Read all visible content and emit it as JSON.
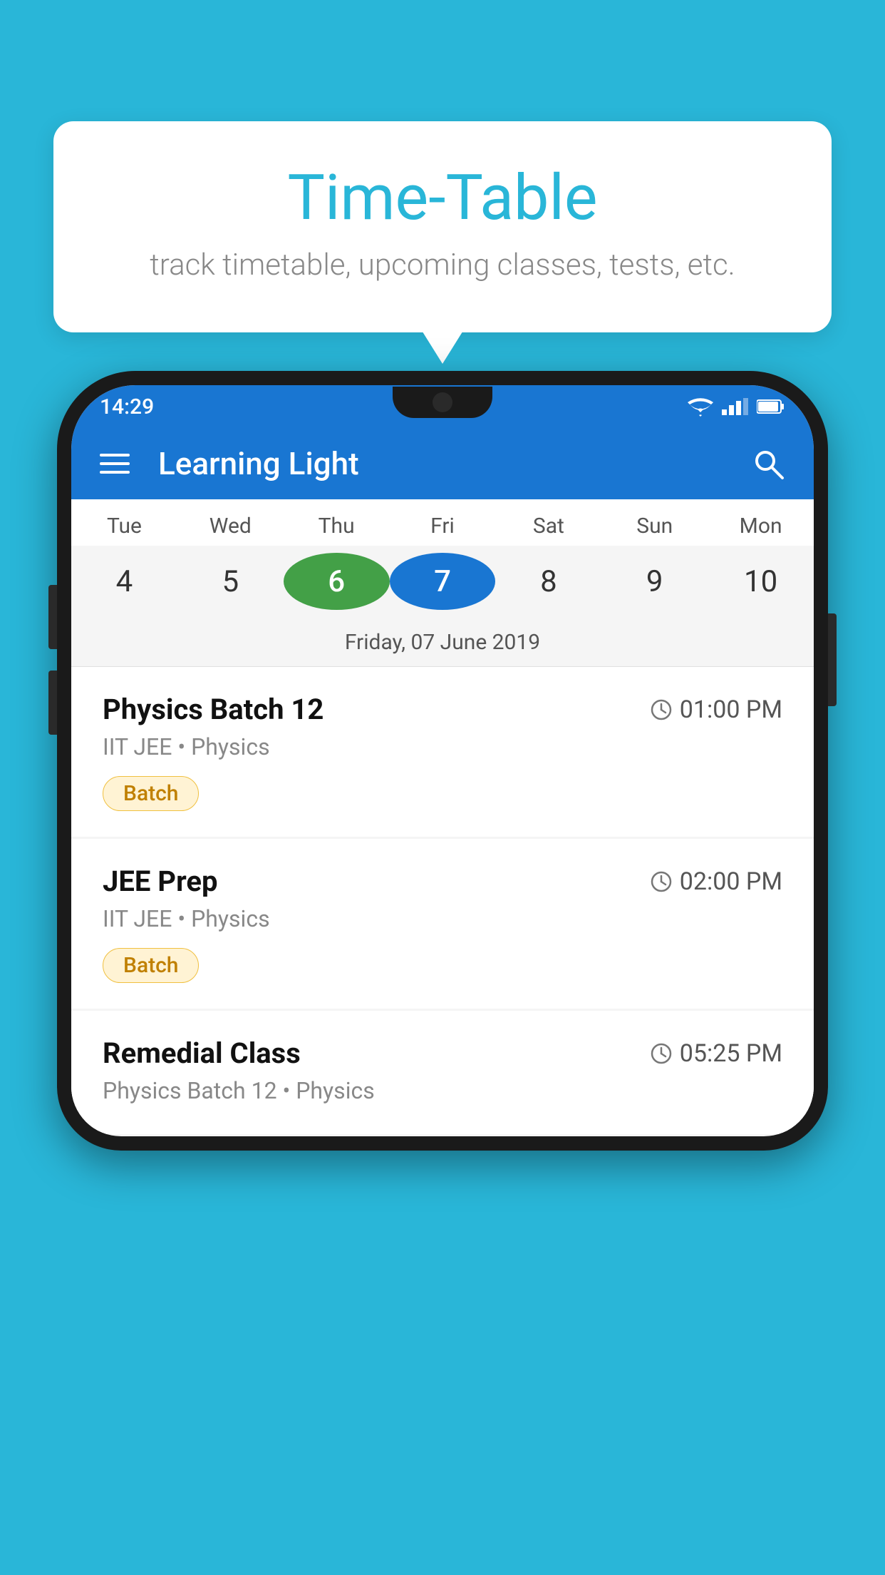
{
  "background_color": "#29b6d8",
  "tooltip": {
    "title": "Time-Table",
    "subtitle": "track timetable, upcoming classes, tests, etc."
  },
  "phone": {
    "status_bar": {
      "time": "14:29"
    },
    "app_bar": {
      "title": "Learning Light"
    },
    "calendar": {
      "days": [
        {
          "name": "Tue",
          "num": "4",
          "state": "normal"
        },
        {
          "name": "Wed",
          "num": "5",
          "state": "normal"
        },
        {
          "name": "Thu",
          "num": "6",
          "state": "today"
        },
        {
          "name": "Fri",
          "num": "7",
          "state": "selected"
        },
        {
          "name": "Sat",
          "num": "8",
          "state": "normal"
        },
        {
          "name": "Sun",
          "num": "9",
          "state": "normal"
        },
        {
          "name": "Mon",
          "num": "10",
          "state": "normal"
        }
      ],
      "selected_date_label": "Friday, 07 June 2019"
    },
    "classes": [
      {
        "name": "Physics Batch 12",
        "time": "01:00 PM",
        "meta": "IIT JEE • Physics",
        "badge": "Batch"
      },
      {
        "name": "JEE Prep",
        "time": "02:00 PM",
        "meta": "IIT JEE • Physics",
        "badge": "Batch"
      },
      {
        "name": "Remedial Class",
        "time": "05:25 PM",
        "meta": "Physics Batch 12 • Physics",
        "badge": null
      }
    ]
  }
}
